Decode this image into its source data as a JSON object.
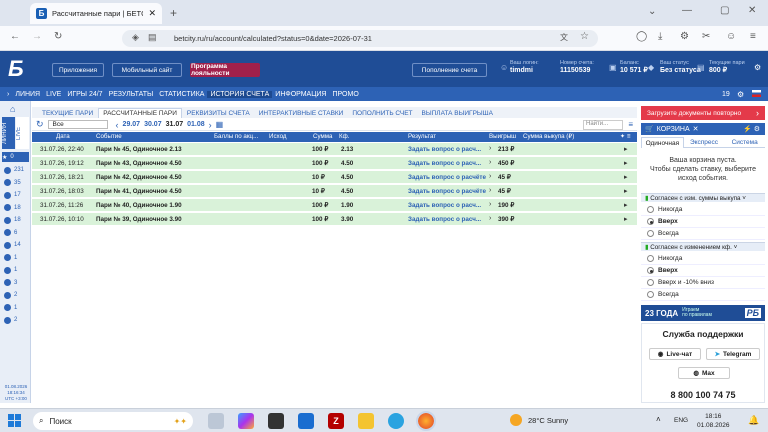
{
  "browser": {
    "tab_title": "Рассчитанные пари | БЕТСИТИ",
    "url": "betcity.ru/ru/account/calculated?status=0&date=2026-07-31"
  },
  "header": {
    "btn_apps": "Приложения",
    "btn_mobile": "Мобильный сайт",
    "btn_loyalty": "Программа лояльности",
    "btn_deposit": "Пополнение счета",
    "user_label": "Ваш логин:",
    "user": "timdmi",
    "account_label": "Номер счета:",
    "account": "11150539",
    "balance_label": "Баланс",
    "balance": "10 571 ₽",
    "status_label": "Ваш статус",
    "status": "Без статуса",
    "bonus_label": "Текущие пари",
    "bonus": "800 ₽"
  },
  "nav": [
    "ЛИНИЯ",
    "LIVE",
    "ИГРЫ 24/7",
    "РЕЗУЛЬТАТЫ",
    "СТАТИСТИКА",
    "ИСТОРИЯ СЧЕТА",
    "ИНФОРМАЦИЯ",
    "ПРОМО"
  ],
  "side": {
    "tab1": "ЛИНИЯ",
    "tab2": "LIVE",
    "fav": "0",
    "counts": [
      "231",
      "35",
      "17",
      "18",
      "18",
      "6",
      "14",
      "1",
      "1",
      "3",
      "2",
      "1",
      "2"
    ],
    "date": "01.08.2026",
    "time": "18:16:34",
    "tz": "UTC +3:00"
  },
  "subtabs": [
    "ТЕКУЩИЕ ПАРИ",
    "РАССЧИТАННЫЕ ПАРИ",
    "РЕКВИЗИТЫ СЧЕТА",
    "ИНТЕРАКТИВНЫЕ СТАВКИ",
    "ПОПОЛНИТЬ СЧЕТ",
    "ВЫПЛАТА ВЫИГРЫША"
  ],
  "filter": {
    "select": "Все",
    "dates": [
      "29.07",
      "30.07",
      "31.07",
      "01.08"
    ],
    "search_placeholder": "Найти..."
  },
  "columns": [
    "Дата",
    "Событие",
    "Баллы по акц...",
    "Исход",
    "Сумма",
    "Кф.",
    "Результат",
    "Выигрыш",
    "Сумма выкупа (₽)"
  ],
  "rows": [
    {
      "date": "31.07.26, 22:40",
      "event": "Пари № 45, Одиночное 2.13",
      "sum": "100 ₽",
      "k": "2.13",
      "result": "Задать вопрос о расч...",
      "win": "213 ₽"
    },
    {
      "date": "31.07.26, 19:12",
      "event": "Пари № 43, Одиночное 4.50",
      "sum": "100 ₽",
      "k": "4.50",
      "result": "Задать вопрос о расч...",
      "win": "450 ₽"
    },
    {
      "date": "31.07.26, 18:21",
      "event": "Пари № 42, Одиночное 4.50",
      "sum": "10 ₽",
      "k": "4.50",
      "result": "Задать вопрос о расчёте",
      "win": "45 ₽"
    },
    {
      "date": "31.07.26, 18:03",
      "event": "Пари № 41, Одиночное 4.50",
      "sum": "10 ₽",
      "k": "4.50",
      "result": "Задать вопрос о расчёте",
      "win": "45 ₽"
    },
    {
      "date": "31.07.26, 11:26",
      "event": "Пари № 40, Одиночное 1.90",
      "sum": "100 ₽",
      "k": "1.90",
      "result": "Задать вопрос о расч...",
      "win": "190 ₽"
    },
    {
      "date": "31.07.26, 10:10",
      "event": "Пари № 39, Одиночное 3.90",
      "sum": "100 ₽",
      "k": "3.90",
      "result": "Задать вопрос о расч...",
      "win": "390 ₽"
    }
  ],
  "right": {
    "promo": "Загрузите документы повторно",
    "cart": "КОРЗИНА",
    "cart_tabs": [
      "Одиночная",
      "Экспресс",
      "Система"
    ],
    "empty1": "Ваша корзина пуста.",
    "empty2": "Чтобы сделать ставку, выберите",
    "empty3": "исход события.",
    "grp1": "Согласен с изм. суммы выкупа",
    "opts1": [
      "Никогда",
      "Вверх",
      "Всегда"
    ],
    "grp2": "Согласен с изменением кф.",
    "opts2": [
      "Никогда",
      "Вверх",
      "Вверх и -10% вниз",
      "Всегда"
    ],
    "banner_big": "23 ГОДА",
    "banner_sm1": "Играем",
    "banner_sm2": "по правилам",
    "banner_logo": "РБ",
    "support_title": "Служба поддержки",
    "live": "Live-чат",
    "telegram": "Telegram",
    "max": "Max",
    "phone": "8 800 100 74 75"
  },
  "taskbar": {
    "search": "Поиск",
    "weather": "28°C  Sunny",
    "lang": "ENG",
    "time": "18:16",
    "date": "01.08.2026"
  },
  "colors": {
    "brand": "#1f4d96",
    "nav": "#2d62b5",
    "row": "#d9f2d9",
    "promo": "#e43a4a"
  }
}
